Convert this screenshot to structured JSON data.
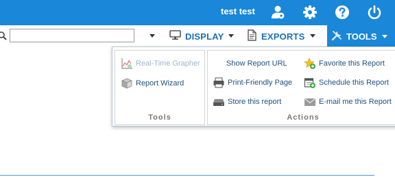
{
  "header": {
    "username": "test test",
    "icons": [
      "user-group-icon",
      "gear-icon",
      "help-icon",
      "power-icon"
    ]
  },
  "toolbar": {
    "search": {
      "value": "",
      "placeholder": ""
    },
    "display_label": "DISPLAY",
    "exports_label": "EXPORTS",
    "tools_label": "TOOLS"
  },
  "dropdown": {
    "tools_panel": {
      "title": "Tools",
      "items": [
        {
          "label": "Real-Time Grapher",
          "icon": "chart-icon",
          "enabled": false
        },
        {
          "label": "Report Wizard",
          "icon": "box-icon",
          "enabled": true
        }
      ]
    },
    "actions_panel": {
      "title": "Actions",
      "items": [
        {
          "label": "Show Report URL",
          "icon": "",
          "enabled": true
        },
        {
          "label": "Favorite this Report",
          "icon": "star-plus-icon",
          "enabled": true
        },
        {
          "label": "Print-Friendly Page",
          "icon": "printer-icon",
          "enabled": true
        },
        {
          "label": "Schedule this Report",
          "icon": "calendar-plus-icon",
          "enabled": true
        },
        {
          "label": "Store this report",
          "icon": "drive-icon",
          "enabled": true
        },
        {
          "label": "E-mail me this Report",
          "icon": "envelope-icon",
          "enabled": true
        }
      ]
    }
  },
  "colors": {
    "brand": "#1a87d8",
    "link": "#1f4f7f",
    "accent": "#1a6fb8"
  }
}
